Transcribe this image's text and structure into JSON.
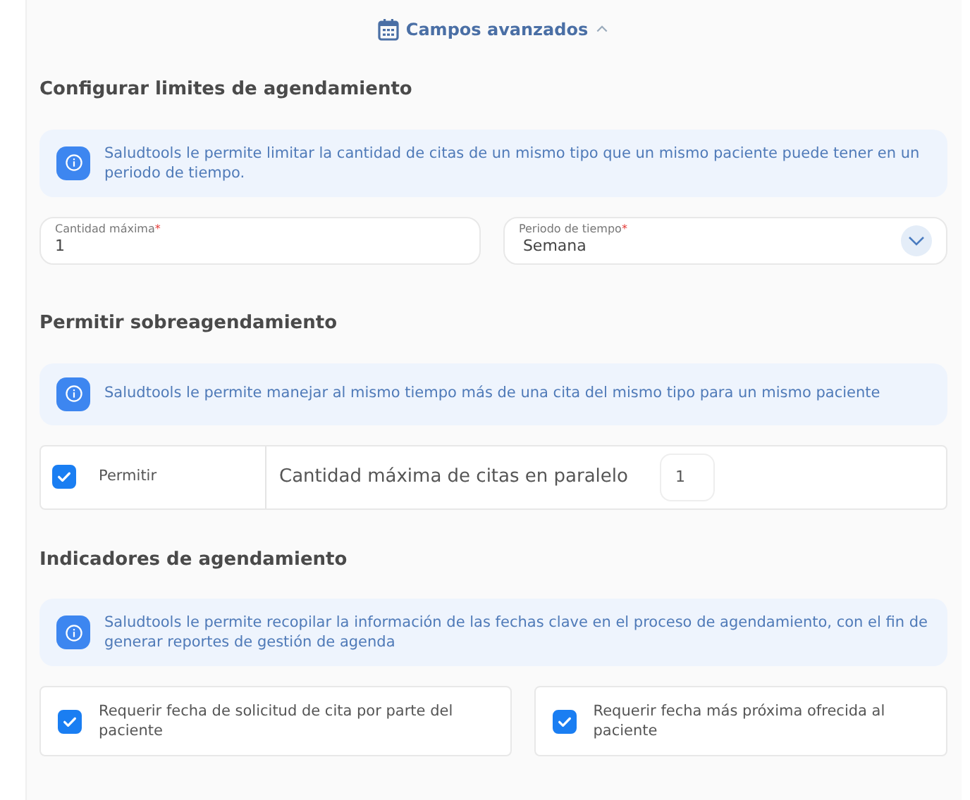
{
  "toggle": {
    "label": "Campos avanzados",
    "expanded": true
  },
  "sections": [
    {
      "title": "Configurar limites de agendamiento",
      "info": "Saludtools le permite limitar la cantidad de citas de un mismo tipo que un mismo paciente puede tener en un periodo de tiempo.",
      "kind": "fields",
      "fields": [
        {
          "kind": "input",
          "label": "Cantidad máxima",
          "required_mark": "*",
          "value": "1"
        },
        {
          "kind": "select",
          "label": "Periodo de tiempo",
          "required_mark": "*",
          "value": "Semana"
        }
      ]
    },
    {
      "title": "Permitir sobreagendamiento",
      "info": "Saludtools le permite manejar al mismo tiempo más de una cita del mismo tipo para un mismo paciente",
      "kind": "overbooking",
      "checkbox": {
        "label": "Permitir",
        "checked": true
      },
      "parallel": {
        "label": "Cantidad máxima de citas en paralelo",
        "value": "1"
      }
    },
    {
      "title": "Indicadores de agendamiento",
      "info": "Saludtools le permite recopilar la información de las fechas clave en el proceso de agendamiento, con el fin de generar reportes de gestión de agenda",
      "kind": "checks",
      "checks": [
        {
          "label": "Requerir fecha de solicitud de cita por parte del paciente",
          "checked": true
        },
        {
          "label": "Requerir fecha más próxima ofrecida al paciente",
          "checked": true
        }
      ]
    }
  ]
}
